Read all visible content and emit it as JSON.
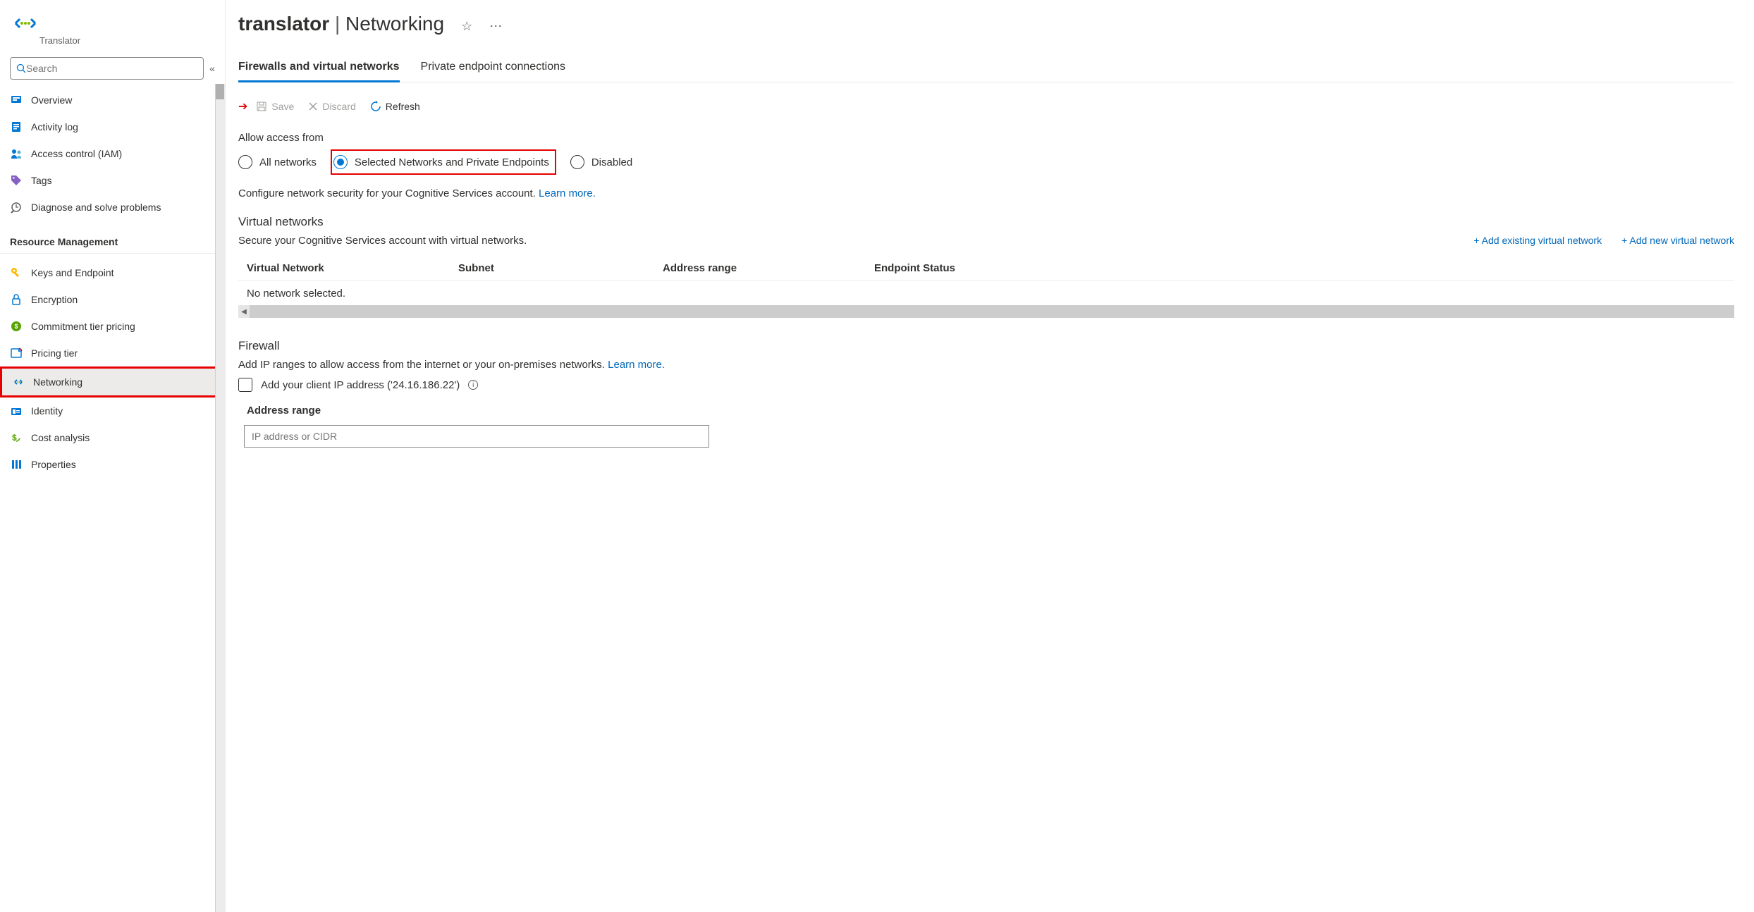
{
  "sidebar": {
    "title": "Translator",
    "search_placeholder": "Search",
    "items_top": [
      {
        "label": "Overview",
        "icon": "overview"
      },
      {
        "label": "Activity log",
        "icon": "log"
      },
      {
        "label": "Access control (IAM)",
        "icon": "iam"
      },
      {
        "label": "Tags",
        "icon": "tags"
      },
      {
        "label": "Diagnose and solve problems",
        "icon": "diag"
      }
    ],
    "section_label": "Resource Management",
    "items_rm": [
      {
        "label": "Keys and Endpoint",
        "icon": "key"
      },
      {
        "label": "Encryption",
        "icon": "lock"
      },
      {
        "label": "Commitment tier pricing",
        "icon": "tier"
      },
      {
        "label": "Pricing tier",
        "icon": "pricing"
      },
      {
        "label": "Networking",
        "icon": "networking",
        "selected": true,
        "highlighted": true
      },
      {
        "label": "Identity",
        "icon": "identity"
      },
      {
        "label": "Cost analysis",
        "icon": "cost"
      },
      {
        "label": "Properties",
        "icon": "props"
      }
    ]
  },
  "header": {
    "name": "translator",
    "page": "Networking"
  },
  "tabs": [
    {
      "label": "Firewalls and virtual networks",
      "active": true
    },
    {
      "label": "Private endpoint connections"
    }
  ],
  "toolbar": {
    "save": "Save",
    "discard": "Discard",
    "refresh": "Refresh"
  },
  "access": {
    "label": "Allow access from",
    "options": [
      {
        "label": "All networks"
      },
      {
        "label": "Selected Networks and Private Endpoints",
        "checked": true,
        "highlighted": true
      },
      {
        "label": "Disabled"
      }
    ],
    "subtext": "Configure network security for your Cognitive Services account.",
    "learn_more": "Learn more."
  },
  "vnet": {
    "title": "Virtual networks",
    "subtext": "Secure your Cognitive Services account with virtual networks.",
    "add_existing": "+ Add existing virtual network",
    "add_new": "+ Add new virtual network",
    "cols": {
      "vnet": "Virtual Network",
      "subnet": "Subnet",
      "addr": "Address range",
      "endpoint": "Endpoint Status"
    },
    "empty": "No network selected."
  },
  "firewall": {
    "title": "Firewall",
    "subtext": "Add IP ranges to allow access from the internet or your on-premises networks.",
    "learn_more": "Learn more.",
    "checkbox": "Add your client IP address ('24.16.186.22')",
    "subhead": "Address range",
    "ip_placeholder": "IP address or CIDR"
  }
}
